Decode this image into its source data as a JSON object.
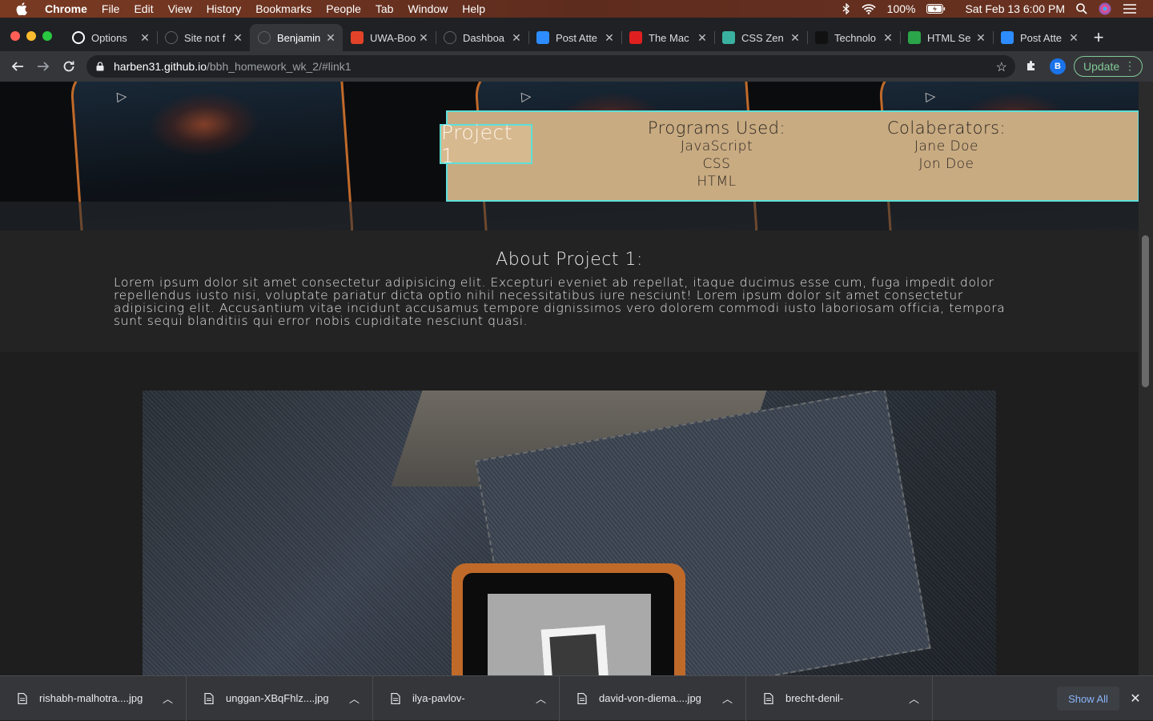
{
  "menubar": {
    "app": "Chrome",
    "items": [
      "File",
      "Edit",
      "View",
      "History",
      "Bookmarks",
      "People",
      "Tab",
      "Window",
      "Help"
    ],
    "battery": "100%",
    "clock": "Sat Feb 13  6:00 PM"
  },
  "tabs": [
    {
      "title": "Options",
      "icon": "github-icon",
      "color": "#ffffff",
      "active": false
    },
    {
      "title": "Site not f",
      "icon": "globe-icon",
      "color": "#5f6368",
      "active": false
    },
    {
      "title": "Benjamin",
      "icon": "globe-icon",
      "color": "#5f6368",
      "active": true
    },
    {
      "title": "UWA-Boo",
      "icon": "gitlab-icon",
      "color": "#e24329",
      "active": false
    },
    {
      "title": "Dashboa",
      "icon": "globe-icon",
      "color": "#5f6368",
      "active": false
    },
    {
      "title": "Post Atte",
      "icon": "zoom-icon",
      "color": "#2d8cff",
      "active": false
    },
    {
      "title": "The Mac",
      "icon": "sub-icon",
      "color": "#e02020",
      "active": false
    },
    {
      "title": "CSS Zen",
      "icon": "zen-icon",
      "color": "#3ab0a0",
      "active": false
    },
    {
      "title": "Technolo",
      "icon": "tech-icon",
      "color": "#111111",
      "active": false
    },
    {
      "title": "HTML Se",
      "icon": "w-icon",
      "color": "#2aa54a",
      "active": false
    },
    {
      "title": "Post Atte",
      "icon": "zoom-icon",
      "color": "#2d8cff",
      "active": false
    }
  ],
  "address": {
    "host": "harben31.github.io",
    "path": "/bbh_homework_wk_2/#link1"
  },
  "toolbar": {
    "profile_initial": "B",
    "update_label": "Update"
  },
  "project": {
    "title": "Project 1",
    "programs_heading": "Programs Used:",
    "programs": [
      "JavaScript",
      "CSS",
      "HTML"
    ],
    "collab_heading": "Colaberators:",
    "collaborators": [
      "Jane Doe",
      "Jon Doe"
    ]
  },
  "about": {
    "title": "About Project 1:",
    "body": "Lorem ipsum dolor sit amet consectetur adipisicing elit. Excepturi eveniet ab repellat, itaque ducimus esse cum, fuga impedit dolor repellendus iusto nisi, voluptate pariatur dicta optio nihil necessitatibus iure nesciunt! Lorem ipsum dolor sit amet consectetur adipisicing elit. Accusantium vitae incidunt accusamus tempore dignissimos vero dolorem commodi iusto laboriosam officia, tempora sunt sequi blanditiis qui error nobis cupiditate nesciunt quasi."
  },
  "downloads": {
    "items": [
      "rishabh-malhotra....jpg",
      "unggan-XBqFhlz....jpg",
      "ilya-pavlov-",
      "david-von-diema....jpg",
      "brecht-denil-"
    ],
    "show_all": "Show All"
  }
}
